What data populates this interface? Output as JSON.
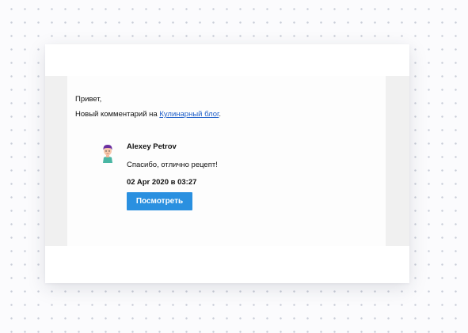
{
  "email": {
    "greeting": "Привет,",
    "notice_prefix": "Новый комментарий на ",
    "blog_link": "Кулинарный блог",
    "notice_suffix": ".",
    "comment": {
      "author": "Alexey Petrov",
      "avatar_icon": "user-avatar-icon",
      "text": "Спасибо, отлично рецепт!",
      "timestamp": "02 Apr 2020 в 03:27",
      "button_label": "Посмотреть"
    }
  },
  "colors": {
    "link": "#1f5fc9",
    "button": "#2a90e0",
    "band": "#f0f0f0"
  }
}
